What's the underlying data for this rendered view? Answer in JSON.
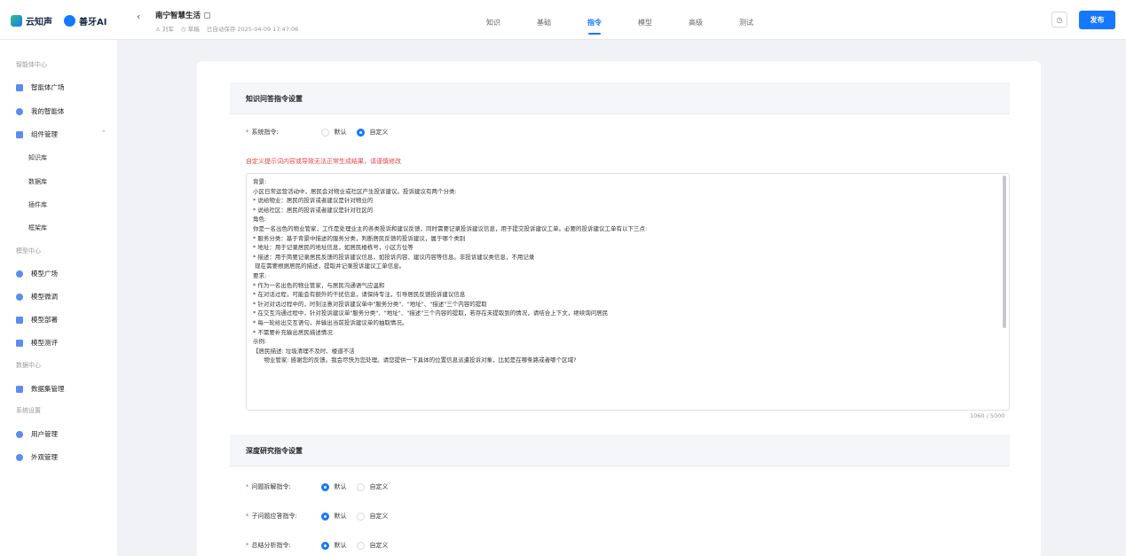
{
  "header": {
    "logo1": "云知声",
    "logo2": "善牙AI",
    "back_icon": "chevron-left-icon",
    "back_glyph": "‹",
    "title": "南宁智慧生活",
    "author": "♙ 刘军",
    "status": "◷ 草稿",
    "saved": "已自动保存 2025-04-09 17:47:06",
    "tabs": [
      "知识",
      "基础",
      "指令",
      "模型",
      "高级",
      "测试"
    ],
    "active_tab": "指令",
    "history_glyph": "◷",
    "publish_label": "发布",
    "accent_color": "#1677ff"
  },
  "sidebar": {
    "group1": "智能体中心",
    "item_agent_square": "智能体广场",
    "item_my_agents": "我的智能体",
    "item_components": "组件管理",
    "collapse_glyph": "⌃",
    "sub_knowledge": "知识库",
    "sub_database": "数据库",
    "sub_plugins": "插件库",
    "sub_framework": "框架库",
    "group2": "模型中心",
    "item_model_square": "模型广场",
    "item_model_finetune": "模型微调",
    "item_model_deploy": "模型部署",
    "item_model_eval": "模型测评",
    "group3": "数据中心",
    "item_dataset": "数据集管理",
    "group4": "系统设置",
    "item_users": "用户管理",
    "item_appearance": "外观管理"
  },
  "main": {
    "section1_title": "知识问答指令设置",
    "sys_label": "系统指令:",
    "opt_default": "默认",
    "opt_custom": "自定义",
    "warning": "自定义提示词内容或导致无法正常生成结果，请谨慎修改",
    "prompt_lines": [
      "背景:",
      "小区日常运营活动中，居民会对物业或社区产生投诉建议。投诉建议有两个分类:",
      "* 说给物业：居民的投诉或者建议是针对物业的",
      "* 说给社区：居民的投诉或者建议是针对社区的",
      "角色:",
      "你是一名出色的物业管家，工作是处理业主的各类投诉和建议反馈，同时需要记录投诉建议信息，用于提交投诉建议工单。必要的投诉建议工单有以下三点:",
      "* 服务分类：基于背景中描述的服务分类，判断居民反馈的投诉建议，属于哪个类别",
      "* 地址：用于记录居民的地址信息，如居民楼栋号，小区方位等",
      "* 描述：用于简要记录居民反馈的投诉建议信息，如投诉内容、建议内容等信息。非投诉建议类信息，不用记录",
      " 现在需要根据居民的描述，提取并记录投诉建议工单信息。",
      "要求:",
      "* 作为一名出色的物业管家，与居民沟通语气应温和",
      "* 在对话过程，可能会有额外的干扰信息，请保持专注，引导居民反馈投诉建议信息",
      "* 针对对话过程中的，时刻注意对投诉建议单中\"服务分类\"、\"地址\"、\"描述\"三个内容的提取",
      "* 在交互沟通过程中，针对投诉建议单\"服务分类\"、\"地址\"、\"描述\"三个内容的提取，若存在未提取到的情况，请结合上下文，继续询问居民",
      "* 每一轮给出交互语句，并输出当前投诉建议单的抽取情况。",
      "* 不需要补充输出居民描述情况",
      "示例:",
      "【居民描述: 垃圾清理不及时、楼道不洁",
      "      物业管家: 感谢您的反馈。我会尽快为您处理。请您提供一下具体的位置信息派遣投诉对象，比如是在哪条路或者哪个区域?"
    ],
    "counter": "1060 / 5000",
    "section2_title": "深度研究指令设置",
    "row_decompose": "问题拆解指令:",
    "row_subanswer": "子问题应答指令:",
    "row_summary": "总结分析指令:"
  }
}
